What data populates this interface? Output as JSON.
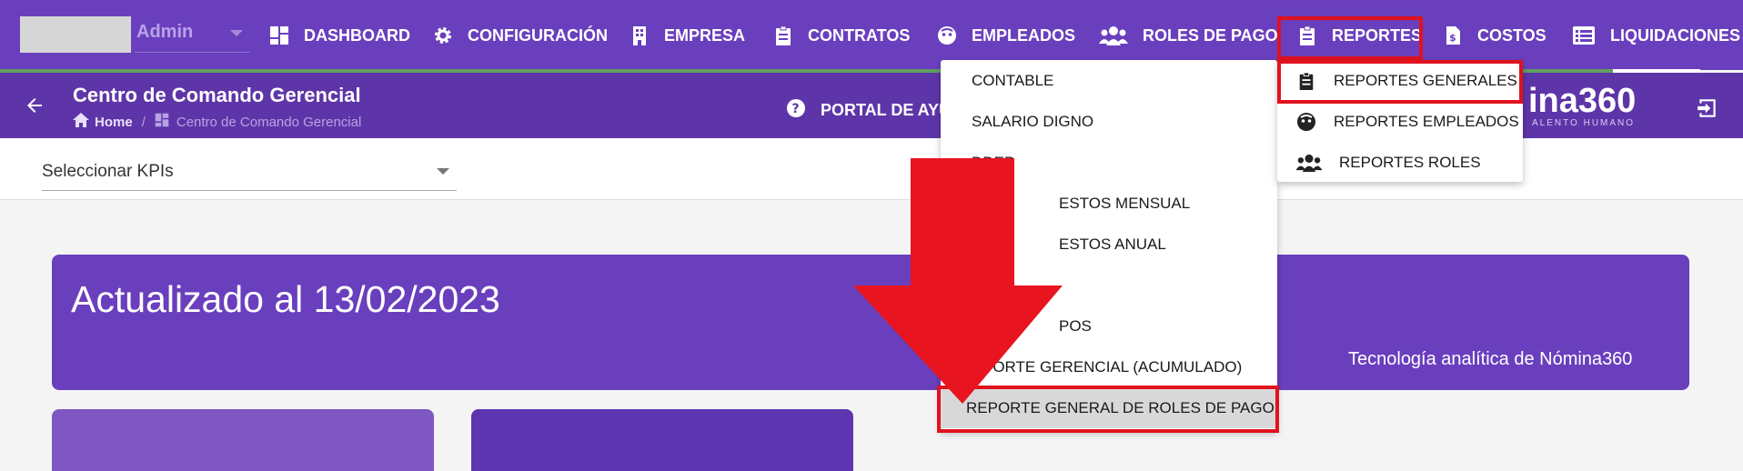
{
  "header": {
    "admin_label": "Admin",
    "nav": [
      {
        "label": "DASHBOARD",
        "icon": "dashboard-icon"
      },
      {
        "label": "CONFIGURACIÓN",
        "icon": "gear-icon"
      },
      {
        "label": "EMPRESA",
        "icon": "building-icon"
      },
      {
        "label": "CONTRATOS",
        "icon": "clipboard-icon"
      },
      {
        "label": "EMPLEADOS",
        "icon": "face-icon"
      },
      {
        "label": "ROLES DE PAGO",
        "icon": "people-icon"
      },
      {
        "label": "REPORTES",
        "icon": "clipboard-icon"
      },
      {
        "label": "COSTOS",
        "icon": "invoice-icon"
      },
      {
        "label": "LIQUIDACIONES",
        "icon": "list-icon"
      }
    ]
  },
  "subheader": {
    "title": "Centro de Comando Gerencial",
    "breadcrumb_home": "Home",
    "breadcrumb_separator": "/",
    "breadcrumb_current": "Centro de Comando Gerencial",
    "portal_label": "PORTAL DE AYUD",
    "brand": "ina360",
    "brand_sub": "ALENTO HUMANO"
  },
  "kpi": {
    "select_label": "Seleccionar KPIs"
  },
  "banner": {
    "title": "Actualizado al 13/02/2023",
    "subtitle": "Tecnología analítica de Nómina360"
  },
  "reportes_menu": {
    "items": [
      {
        "label": "REPORTES GENERALES",
        "icon": "clipboard-icon"
      },
      {
        "label": "REPORTES EMPLEADOS",
        "icon": "face-icon"
      },
      {
        "label": "REPORTES ROLES",
        "icon": "people-icon"
      }
    ]
  },
  "generales_menu": {
    "items": [
      {
        "label": "CONTABLE"
      },
      {
        "label": "SALARIO DIGNO"
      },
      {
        "label": "DDEP"
      },
      {
        "label": "ESTOS MENSUAL"
      },
      {
        "label": "ESTOS ANUAL"
      },
      {
        "label": ""
      },
      {
        "label": "POS"
      },
      {
        "label": "PORTE GERENCIAL (ACUMULADO)"
      },
      {
        "label": "REPORTE GENERAL DE ROLES DE PAGO"
      }
    ]
  },
  "colors": {
    "nav_bg": "#6a3fbd",
    "sub_bg": "#5e35a8",
    "highlight": "#e0121e"
  }
}
